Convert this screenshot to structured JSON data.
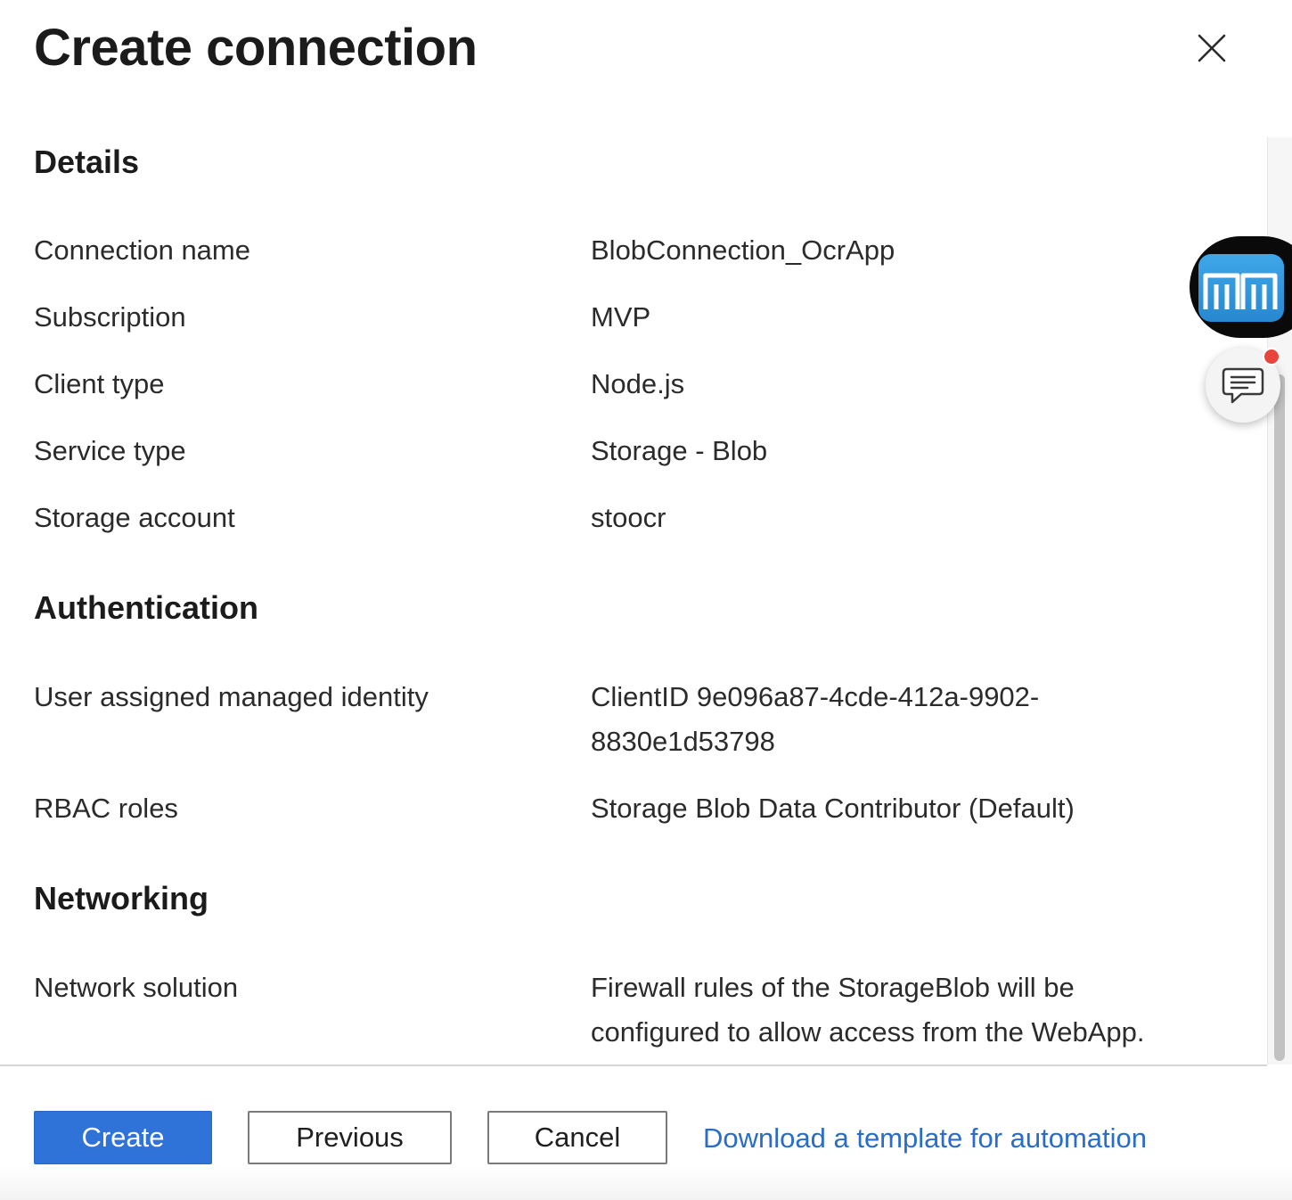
{
  "panel": {
    "title": "Create connection",
    "close_icon": "close-icon"
  },
  "details": {
    "heading": "Details",
    "rows": [
      {
        "label": "Connection name",
        "value": "BlobConnection_OcrApp"
      },
      {
        "label": "Subscription",
        "value": "MVP"
      },
      {
        "label": "Client type",
        "value": "Node.js"
      },
      {
        "label": "Service type",
        "value": "Storage - Blob"
      },
      {
        "label": "Storage account",
        "value": "stoocr"
      }
    ]
  },
  "authentication": {
    "heading": "Authentication",
    "rows": [
      {
        "label": "User assigned managed identity",
        "value_line1": "ClientID 9e096a87-4cde-412a-9902-",
        "value_line2": "8830e1d53798"
      },
      {
        "label": "RBAC roles",
        "value": "Storage Blob Data Contributor (Default)"
      }
    ]
  },
  "networking": {
    "heading": "Networking",
    "rows": [
      {
        "label": "Network solution",
        "value_line1": "Firewall rules of the StorageBlob will be",
        "value_line2": "configured to allow access from the WebApp."
      }
    ]
  },
  "footer": {
    "create_label": "Create",
    "previous_label": "Previous",
    "cancel_label": "Cancel",
    "download_link": "Download a template for automation"
  },
  "overlay": {
    "app_icon": "mm-app-icon",
    "feedback_icon": "feedback-chat-icon"
  },
  "colors": {
    "primary": "#2f72d8",
    "link": "#2a6cc9",
    "notification": "#e8453c"
  }
}
